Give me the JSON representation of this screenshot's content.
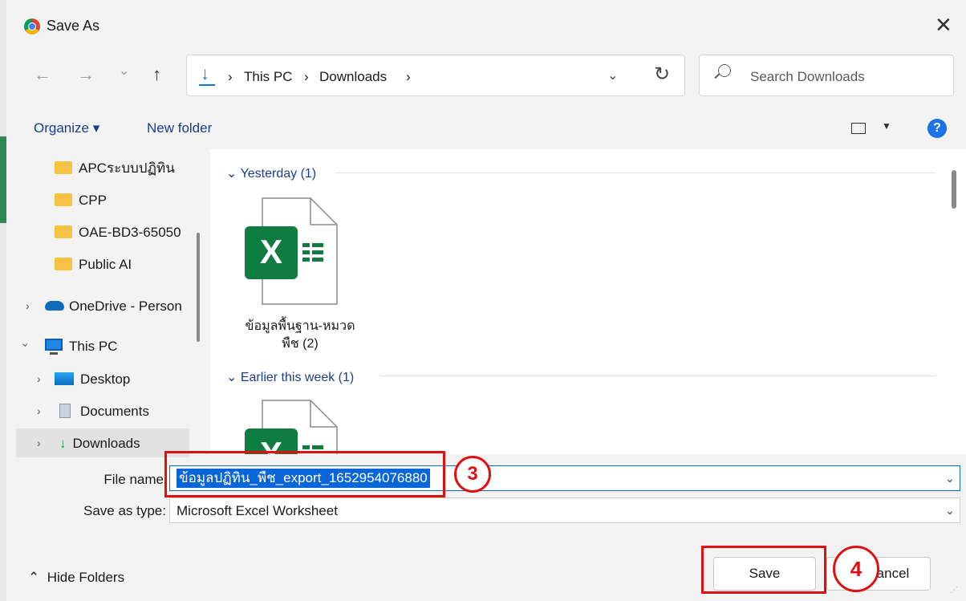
{
  "window": {
    "title": "Save As",
    "close_glyph": "✕"
  },
  "nav": {
    "back_glyph": "←",
    "forward_glyph": "→",
    "recent_glyph": "⌄",
    "up_glyph": "↑"
  },
  "address": {
    "crumbs": [
      "This PC",
      "Downloads"
    ],
    "sep": "›",
    "dropdown_glyph": "⌄",
    "refresh_glyph": "↻"
  },
  "search": {
    "placeholder": "Search Downloads"
  },
  "toolbar": {
    "organize": "Organize ▾",
    "new_folder": "New folder",
    "help": "?"
  },
  "nav_pane": {
    "items": [
      {
        "label": "APCระบบปฏิทิน",
        "icon": "folder-icon"
      },
      {
        "label": "CPP",
        "icon": "folder-icon"
      },
      {
        "label": "OAE-BD3-65050",
        "icon": "folder-icon"
      },
      {
        "label": "Public AI",
        "icon": "folder-icon"
      },
      {
        "label": "OneDrive - Person",
        "icon": "onedrive-icon"
      },
      {
        "label": "This PC",
        "icon": "pc-icon"
      },
      {
        "label": "Desktop",
        "icon": "desktop-icon"
      },
      {
        "label": "Documents",
        "icon": "documents-icon"
      },
      {
        "label": "Downloads",
        "icon": "downloads-icon"
      }
    ]
  },
  "content": {
    "groups": [
      {
        "header": "Yesterday (1)",
        "files": [
          {
            "name_line1": "ข้อมูลพื้นฐาน-หมวด",
            "name_line2": "พืช (2)"
          }
        ]
      },
      {
        "header": "Earlier this week (1)",
        "files": []
      }
    ]
  },
  "fields": {
    "file_name_label": "File name",
    "file_name_value": "ข้อมูลปฏิทิน_พืช_export_1652954076880",
    "save_type_label": "Save as type:",
    "save_type_value": "Microsoft Excel Worksheet"
  },
  "footer": {
    "hide_folders": "Hide Folders",
    "save": "Save",
    "cancel": "ancel"
  },
  "annotations": {
    "step3": "3",
    "step4": "4"
  },
  "colors": {
    "accent": "#0f6cbd",
    "highlight": "#e01010",
    "excel_green": "#107c41"
  }
}
